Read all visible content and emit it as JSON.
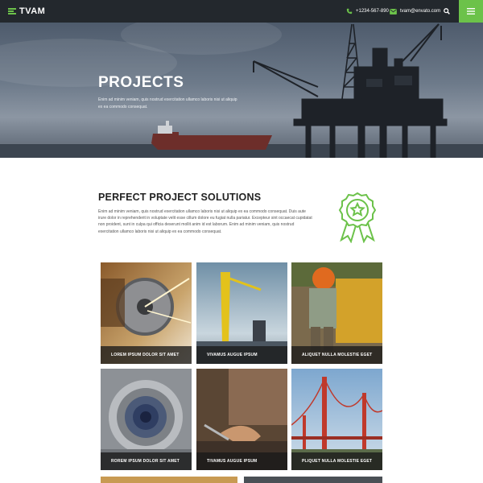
{
  "header": {
    "logo": "TVAM",
    "phone": "+1234-567-890",
    "email": "tvam@envato.com"
  },
  "hero": {
    "title": "PROJECTS",
    "text": "Enim ad minim veniam, quis nostrud exercitation ullamco laboris nisi ut aliquip ex ea commodo consequat."
  },
  "solutions": {
    "title": "PERFECT PROJECT SOLUTIONS",
    "text": "Enim ad minim veniam, quis nostrud exercitation ullamco laboris nisi ut aliquip ex ea commodo consequat. Duis aute irure dolor in reprehenderit in voluptate velit esse cillum dolore eu fugiat nulla pariatur. Excepteur sint occaecat cupidatat non proident, sunt in culpa qui officia deserunt mollit anim id est laborum. Enim ad minim veniam, quis nostrud exercitation ullamco laboris nisi ut aliquip ex ea commodo consequat."
  },
  "projects": [
    {
      "caption": "LOREM IPSUM DOLOR SIT AMET"
    },
    {
      "caption": "VIVAMUS AUGUE IPSUM"
    },
    {
      "caption": "ALIQUET NULLA MOLESTIE EGET"
    },
    {
      "caption": "ROREM IPSUM DOLOR SIT AMET"
    },
    {
      "caption": "TIVAMUS AUGUE IPSUM"
    },
    {
      "caption": "PLIQUET NULLA MOLESTIE EGET"
    }
  ],
  "colors": {
    "accent": "#6cc24a",
    "topbar": "#23282d"
  }
}
